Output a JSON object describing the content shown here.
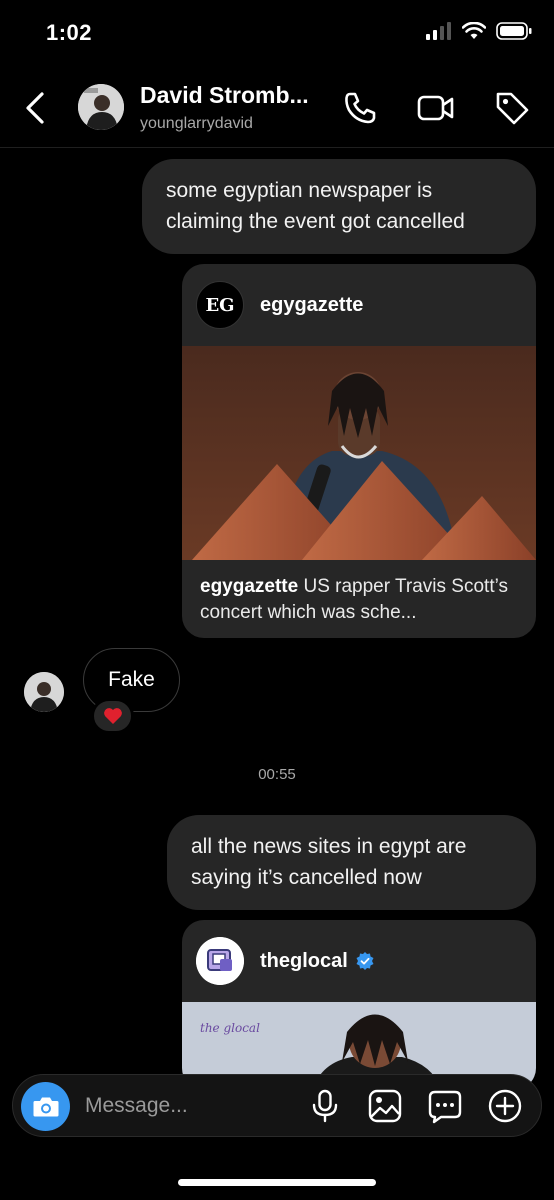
{
  "status_bar": {
    "time": "1:02",
    "icons": [
      "signal-icon",
      "wifi-icon",
      "battery-icon"
    ]
  },
  "header": {
    "name": "David Stromb...",
    "handle": "younglarrydavid",
    "actions": [
      "phone-icon",
      "video-icon",
      "tag-icon"
    ]
  },
  "messages": [
    {
      "type": "sent_text",
      "text": "some egyptian newspaper is claiming the event got cancelled"
    },
    {
      "type": "shared_post",
      "username": "egygazette",
      "avatar_text": "EG",
      "caption_user": "egygazette",
      "caption": "US rapper Travis Scott’s concert which was sche..."
    },
    {
      "type": "received_text",
      "text": "Fake",
      "reaction": "❤️"
    },
    {
      "type": "timestamp",
      "text": "00:55"
    },
    {
      "type": "sent_text",
      "text": "all the news sites in egypt are saying it’s cancelled now"
    },
    {
      "type": "shared_post",
      "username": "theglocal",
      "verified": true,
      "image_watermark": "the glocal"
    }
  ],
  "composer": {
    "placeholder": "Message...",
    "icons": [
      "camera-icon",
      "microphone-icon",
      "image-icon",
      "sticker-icon",
      "plus-icon"
    ]
  },
  "colors": {
    "background": "#000000",
    "bubble": "#262626",
    "accent": "#3797f0",
    "muted": "#a8a8a8",
    "heart": "#e0212e"
  }
}
